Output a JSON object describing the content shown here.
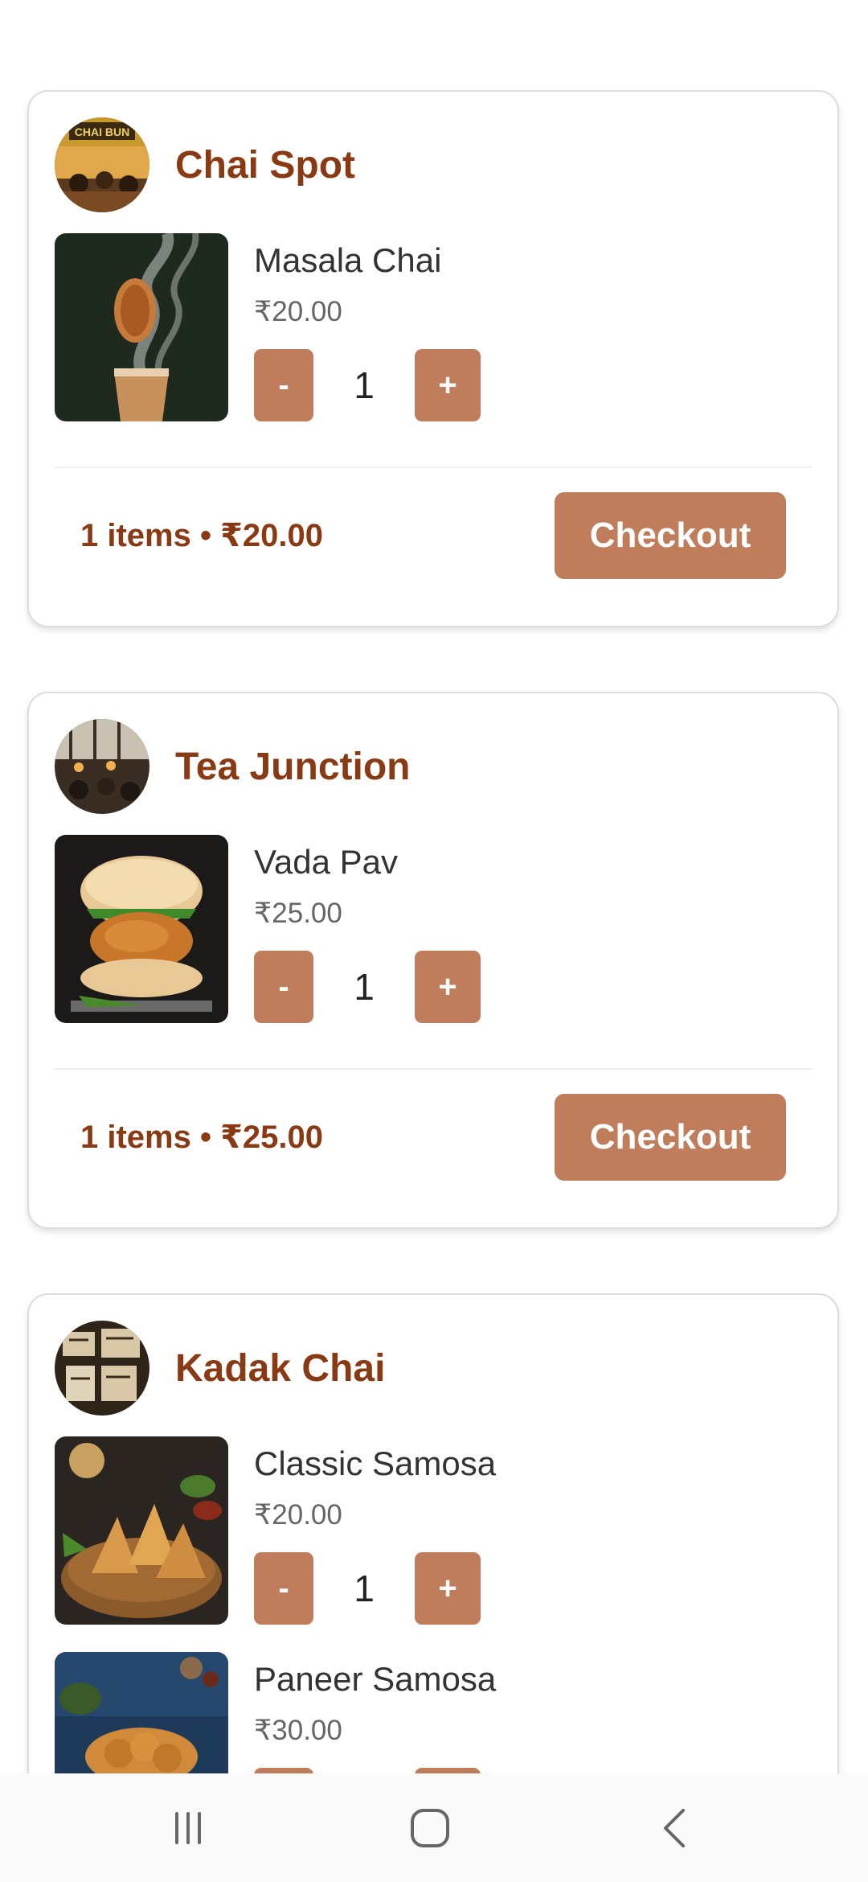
{
  "carts": [
    {
      "vendor": "Chai Spot",
      "items": [
        {
          "name": "Masala Chai",
          "price": "₹20.00",
          "qty": "1"
        }
      ],
      "summary": "1 items • ₹20.00",
      "checkout_label": "Checkout"
    },
    {
      "vendor": "Tea Junction",
      "items": [
        {
          "name": "Vada Pav",
          "price": "₹25.00",
          "qty": "1"
        }
      ],
      "summary": "1 items • ₹25.00",
      "checkout_label": "Checkout"
    },
    {
      "vendor": "Kadak Chai",
      "items": [
        {
          "name": "Classic Samosa",
          "price": "₹20.00",
          "qty": "1"
        },
        {
          "name": "Paneer Samosa",
          "price": "₹30.00",
          "qty": ""
        }
      ]
    }
  ],
  "controls": {
    "minus_label": "-",
    "plus_label": "+"
  },
  "navbar": {
    "icons": [
      "recent-apps-icon",
      "home-icon",
      "back-icon"
    ]
  },
  "colors": {
    "accent": "#c07d5c",
    "vendor_text": "#8a3a12",
    "card_border": "#dcdcdc"
  }
}
